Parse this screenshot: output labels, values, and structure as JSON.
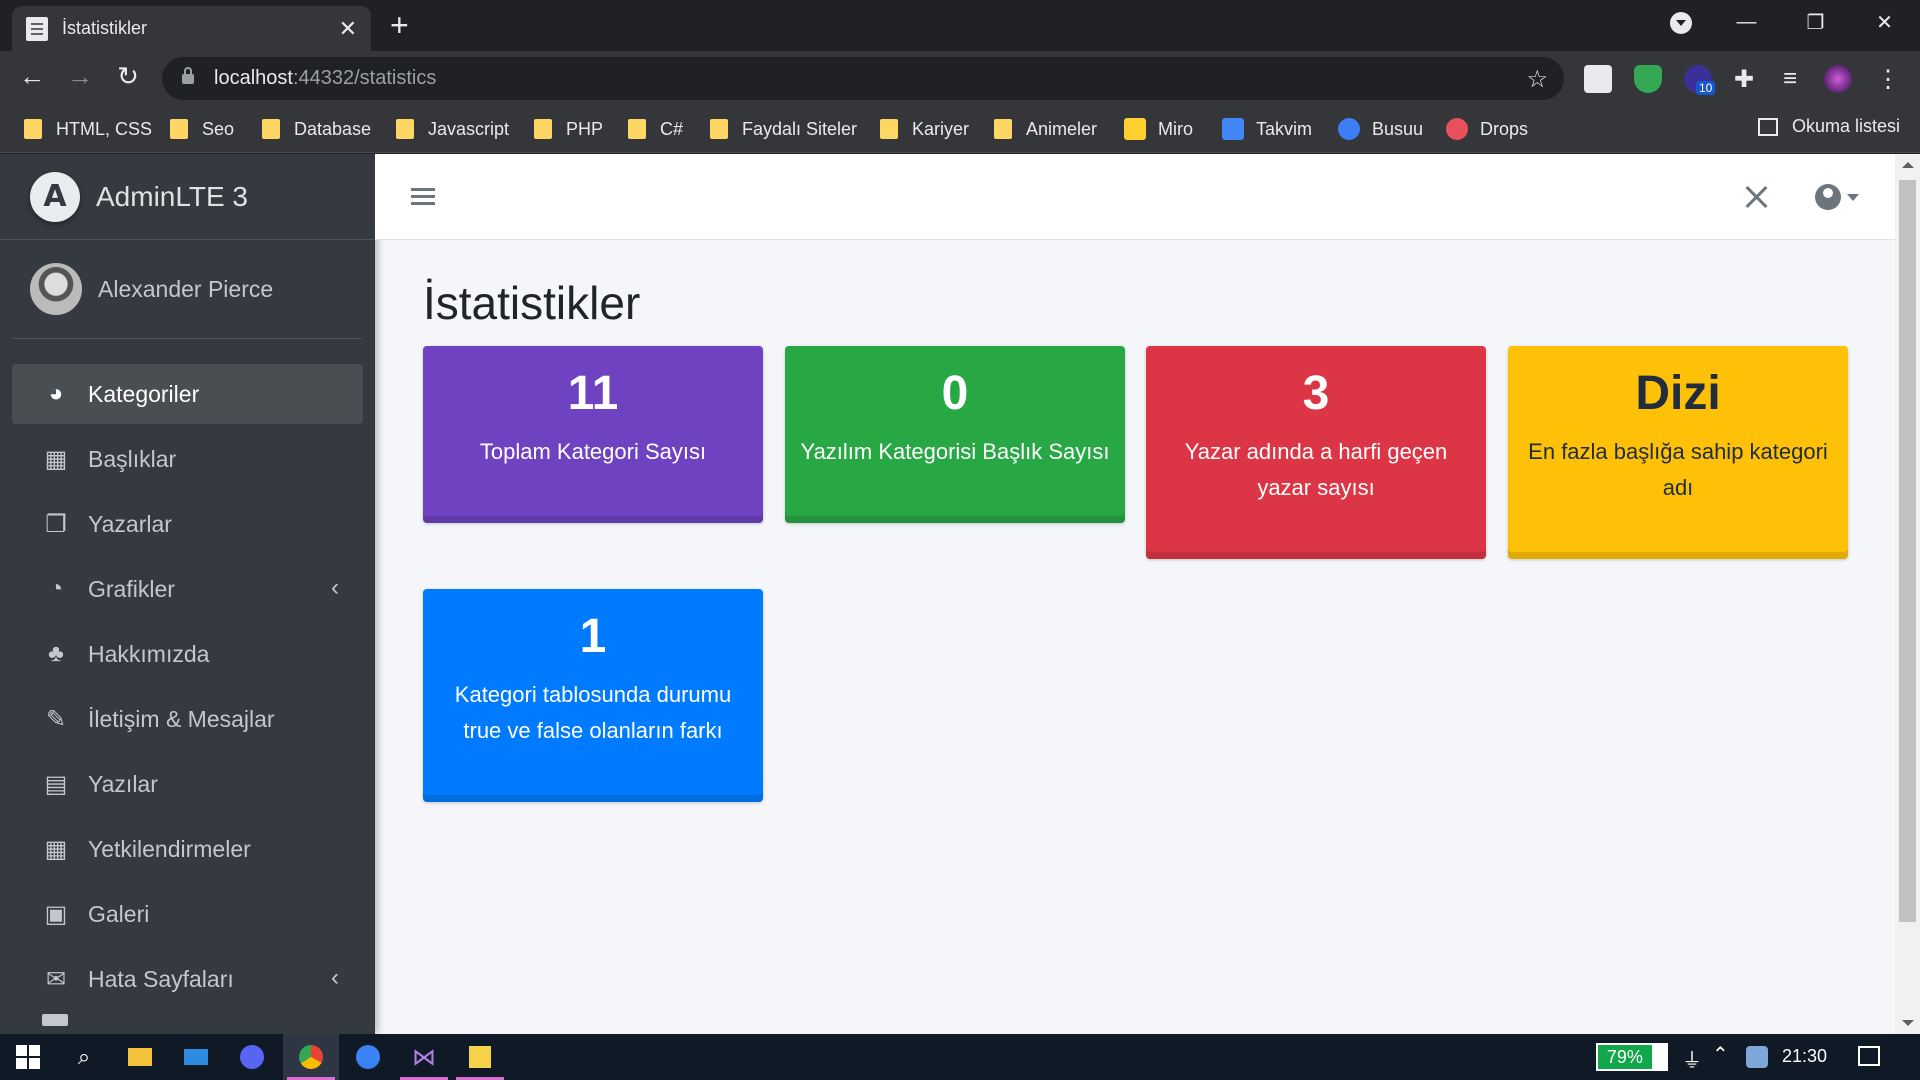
{
  "browser": {
    "tab_title": "İstatistikler",
    "tab_close": "✕",
    "new_tab": "+",
    "url_host": "localhost",
    "url_rest": ":44332/statistics",
    "bookmarks": [
      "HTML, CSS",
      "Seo",
      "Database",
      "Javascript",
      "PHP",
      "C#",
      "Faydalı Siteler",
      "Kariyer",
      "Animeler"
    ],
    "app_bookmarks": [
      {
        "label": "Miro",
        "icon": "miro-icon",
        "color": "#ffd02f"
      },
      {
        "label": "Takvim",
        "icon": "calendar-icon",
        "color": "#4285f4"
      },
      {
        "label": "Busuu",
        "icon": "busuu-icon",
        "color": "#3d7df5"
      },
      {
        "label": "Drops",
        "icon": "drops-icon",
        "color": "#e8505b"
      }
    ],
    "reading_list": "Okuma listesi",
    "extension_badge": "10"
  },
  "app": {
    "brand": "AdminLTE 3",
    "user_name": "Alexander Pierce",
    "menu": [
      {
        "label": "Kategoriler",
        "icon": "dashboard-icon",
        "glyph": "◕",
        "active": true
      },
      {
        "label": "Başlıklar",
        "icon": "grid-icon",
        "glyph": "▦"
      },
      {
        "label": "Yazarlar",
        "icon": "copy-icon",
        "glyph": "❐"
      },
      {
        "label": "Grafikler",
        "icon": "pie-chart-icon",
        "glyph": "◔",
        "chevron": "‹"
      },
      {
        "label": "Hakkımızda",
        "icon": "tree-icon",
        "glyph": "♣"
      },
      {
        "label": "İletişim & Mesajlar",
        "icon": "edit-icon",
        "glyph": "✎"
      },
      {
        "label": "Yazılar",
        "icon": "table-icon",
        "glyph": "▤"
      },
      {
        "label": "Yetkilendirmeler",
        "icon": "calendar-icon",
        "glyph": "▦"
      },
      {
        "label": "Galeri",
        "icon": "image-icon",
        "glyph": "▣"
      },
      {
        "label": "Hata Sayfaları",
        "icon": "envelope-icon",
        "glyph": "✉",
        "chevron": "‹"
      }
    ],
    "page_title": "İstatistikler",
    "stat_boxes": [
      {
        "value": "11",
        "label": "Toplam Kategori Sayısı",
        "color": "#6f42c1"
      },
      {
        "value": "0",
        "label": "Yazılım Kategorisi Başlık Sayısı",
        "color": "#28a745"
      },
      {
        "value": "3",
        "label": "Yazar adında a harfi geçen yazar sayısı",
        "color": "#dc3545"
      },
      {
        "value": "Dizi",
        "label": "En fazla başlığa sahip kategori adı",
        "color": "#ffc107",
        "dark_text": true
      },
      {
        "value": "1",
        "label": "Kategori tablosunda durumu true ve false olanların farkı",
        "color": "#007bff"
      }
    ]
  },
  "taskbar": {
    "battery": "79%",
    "time": "21:30"
  }
}
